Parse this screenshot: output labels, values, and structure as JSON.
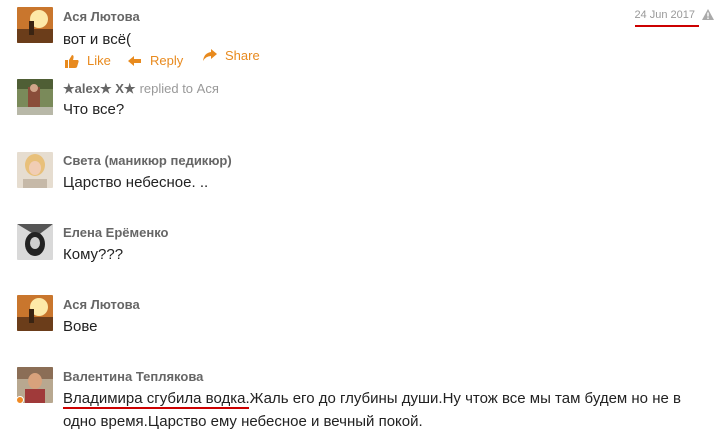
{
  "comments": [
    {
      "author": "Ася Лютова",
      "text": "вот и всё(",
      "date": "24 Jun 2017"
    },
    {
      "author": "★alex★ X★",
      "reply_to": "replied to Ася",
      "text": "Что все?"
    },
    {
      "author": "Света (маникюр педикюр)",
      "text": "Царство небесное. .."
    },
    {
      "author": "Елена Ерёменко",
      "text": "Кому???"
    },
    {
      "author": "Ася Лютова",
      "text": "Вове"
    },
    {
      "author": "Валентина Теплякова",
      "text_underlined": "Владимира сгубила водка",
      "text_rest": ".Жаль его до глубины души.Ну чтож все мы там будем но не в",
      "text_line2": "одно время.Царство ему небесное и вечный покой."
    }
  ],
  "actions": {
    "like": "Like",
    "reply": "Reply",
    "share": "Share"
  },
  "icons": {
    "like": "thumbs-up-icon",
    "reply": "reply-arrow-icon",
    "share": "share-arrow-icon",
    "warning": "warning-icon"
  },
  "colors": {
    "action": "#e88a1e",
    "underline": "#cc0000",
    "author": "#666666",
    "online": "#f08a24"
  }
}
